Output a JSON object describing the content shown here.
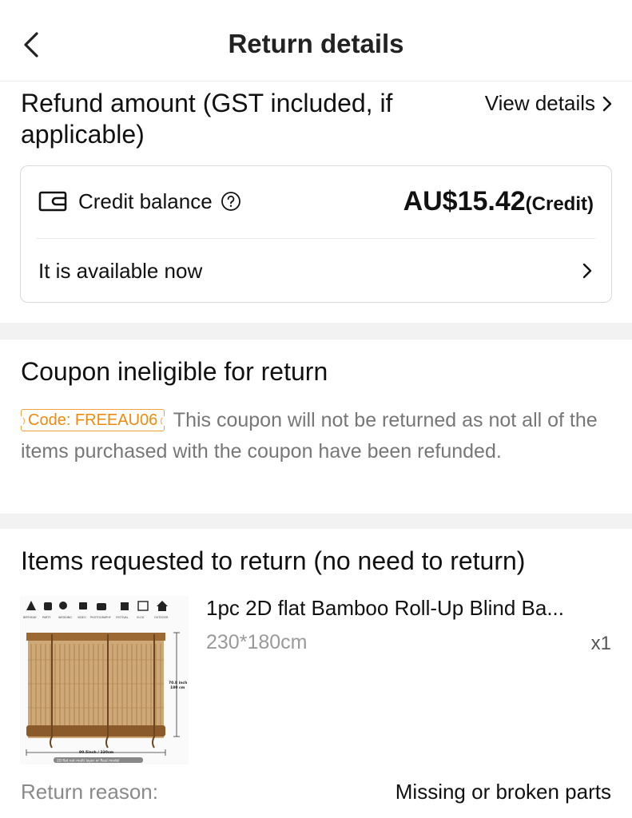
{
  "header": {
    "title": "Return details",
    "back_icon": "chevron-left-icon"
  },
  "refund": {
    "title": "Refund amount (GST included, if applicable)",
    "view_details_label": "View details",
    "credit_label": "Credit balance",
    "amount": "AU$15.42",
    "amount_suffix": "(Credit)",
    "availability_text": "It is available now",
    "icons": [
      "wallet-icon",
      "help-icon",
      "chevron-right-icon"
    ]
  },
  "coupon": {
    "title": "Coupon ineligible for return",
    "code_label": "Code: FREEAU06",
    "description": "This coupon will not be returned as not all of the items purchased with the coupon have been refunded.",
    "accent_color": "#f08a0e"
  },
  "items": {
    "title": "Items requested to return (no need to return)",
    "product": {
      "name": "1pc 2D flat Bamboo Roll-Up Blind Ba...",
      "variant": "230*180cm",
      "quantity": "x1",
      "image_texts": {
        "height_label": "70.8 inch",
        "height_cm": "180 cm",
        "width_label": "90.5inch / 230cm",
        "note": "2D flat not multi layer or Real model",
        "categories": [
          "BIRTHDAY",
          "PARTY",
          "WEDDING",
          "VIDEO",
          "PHOTOGRAPHY",
          "FESTIVAL",
          "VLOG",
          "OUTDOOR"
        ]
      }
    },
    "reason_label": "Return reason:",
    "reason_value": "Missing or broken parts"
  }
}
